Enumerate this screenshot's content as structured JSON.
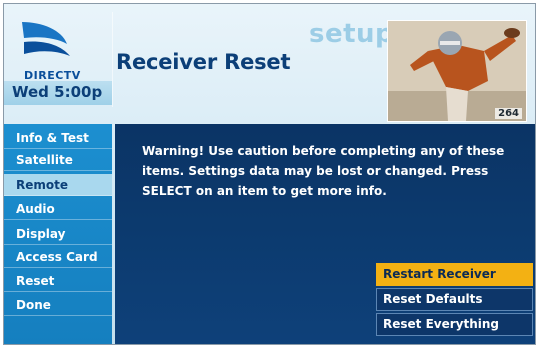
{
  "brand": {
    "name": "DIRECTV"
  },
  "header": {
    "section_title": "setup",
    "page_title": "Receiver Reset",
    "clock": "Wed 5:00p",
    "channel": "264"
  },
  "menu": {
    "items": [
      {
        "label": "Info & Test"
      },
      {
        "label": "Satellite"
      },
      {
        "label": "Remote",
        "selected": true
      },
      {
        "label": "Audio"
      },
      {
        "label": "Display"
      },
      {
        "label": "Access Card"
      },
      {
        "label": "Reset"
      },
      {
        "label": "Done"
      }
    ]
  },
  "content": {
    "warning": "Warning! Use caution before completing any of these items. Settings data may be lost or changed. Press SELECT on an item to get more info.",
    "options": [
      {
        "label": "Restart Receiver",
        "highlighted": true
      },
      {
        "label": "Reset Defaults"
      },
      {
        "label": "Reset Everything"
      }
    ]
  },
  "colors": {
    "menu_bg": "#1c8fd0",
    "content_bg": "#0c3a6e",
    "highlight": "#f3b113",
    "title": "#0c3f78"
  },
  "icons": {
    "logo": "directv-cyclone-logo",
    "pip": "video-preview-football-player"
  }
}
